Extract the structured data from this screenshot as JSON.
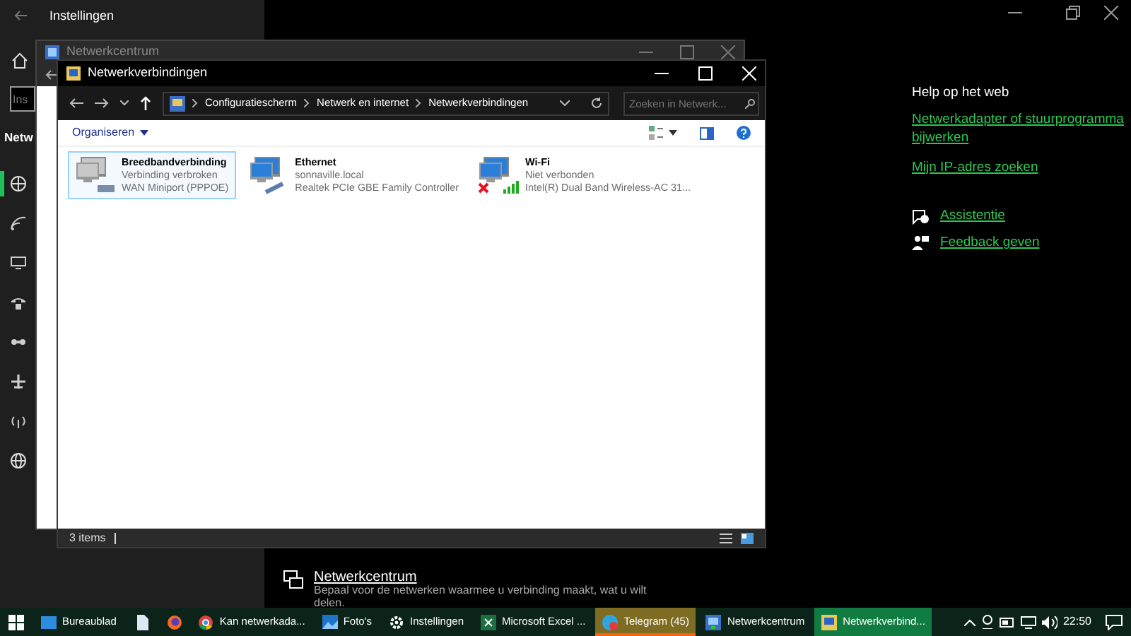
{
  "settings": {
    "title": "Instellingen",
    "search": {
      "placeholder": "Ins"
    },
    "heading": "Netw",
    "nav": [
      {
        "kind": "status",
        "selected": true
      },
      {
        "kind": "wifi",
        "selected": false
      },
      {
        "kind": "ethernet",
        "selected": false
      },
      {
        "kind": "dialup",
        "selected": false
      },
      {
        "kind": "vpn",
        "selected": false
      },
      {
        "kind": "airplane",
        "selected": false
      },
      {
        "kind": "hotspot",
        "selected": false
      },
      {
        "kind": "proxy",
        "selected": false
      }
    ],
    "help_heading": "Help op het web",
    "help_links": [
      "Netwerkadapter of stuurprogramma bijwerken",
      "Mijn IP-adres zoeken"
    ],
    "support": [
      {
        "kind": "assist",
        "label": "Assistentie"
      },
      {
        "kind": "feedback",
        "label": "Feedback geven"
      }
    ],
    "related": {
      "title": "Netwerkcentrum",
      "description": "Bepaal voor de netwerken waarmee u verbinding maakt, wat u wilt delen."
    }
  },
  "background_window": {
    "title": "Netwerkcentrum"
  },
  "explorer": {
    "title": "Netwerkverbindingen",
    "breadcrumb": [
      "Configuratiescherm",
      "Netwerk en internet",
      "Netwerkverbindingen"
    ],
    "search": {
      "placeholder": "Zoeken in Netwerk..."
    },
    "organize": "Organiseren",
    "connections": [
      {
        "kind": "broadband",
        "name": "Breedbandverbinding",
        "status": "Verbinding verbroken",
        "device": "WAN Miniport (PPPOE)",
        "selected": true,
        "error": false
      },
      {
        "kind": "ethernet",
        "name": "Ethernet",
        "status": "sonnaville.local",
        "device": "Realtek PCIe GBE Family Controller",
        "selected": false,
        "error": false
      },
      {
        "kind": "wifi",
        "name": "Wi-Fi",
        "status": "Niet verbonden",
        "device": "Intel(R) Dual Band Wireless-AC 31...",
        "selected": false,
        "error": true
      }
    ],
    "status": "3 items"
  },
  "taskbar": {
    "items": [
      {
        "kind": "start",
        "selected": false,
        "flashing": false
      },
      {
        "kind": "desktop",
        "label": "Bureaublad",
        "selected": false,
        "flashing": false
      },
      {
        "kind": "file",
        "selected": false,
        "flashing": false
      },
      {
        "kind": "firefox",
        "selected": false,
        "flashing": false
      },
      {
        "kind": "chrome",
        "label": "Kan netwerkada...",
        "selected": false,
        "flashing": false
      },
      {
        "kind": "photos",
        "label": "Foto's",
        "selected": false,
        "flashing": false
      },
      {
        "kind": "settings",
        "label": "Instellingen",
        "selected": false,
        "flashing": false
      },
      {
        "kind": "excel",
        "label": "Microsoft Excel ...",
        "selected": false,
        "flashing": false
      },
      {
        "kind": "telegram",
        "label": "Telegram (45)",
        "selected": false,
        "flashing": true
      },
      {
        "kind": "network",
        "label": "Netwerkcentrum",
        "selected": false,
        "flashing": false
      },
      {
        "kind": "connections",
        "label": "Netwerkverbind...",
        "selected": true,
        "flashing": false
      }
    ],
    "clock": "22:50"
  }
}
